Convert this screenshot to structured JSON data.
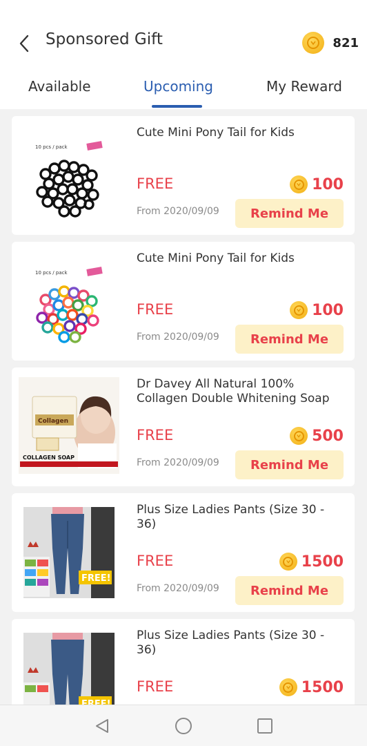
{
  "header": {
    "title": "Sponsored Gift",
    "coin_balance": "821"
  },
  "tabs": [
    {
      "label": "Available"
    },
    {
      "label": "Upcoming",
      "active": true
    },
    {
      "label": "My Reward"
    }
  ],
  "items": [
    {
      "name": "Cute Mini Pony Tail for Kids",
      "price_label": "FREE",
      "coins": "100",
      "date": "From 2020/09/09",
      "action": "Remind Me",
      "image": "black-hair-ties",
      "image_caption": "10 pcs / pack"
    },
    {
      "name": "Cute Mini Pony Tail for Kids",
      "price_label": "FREE",
      "coins": "100",
      "date": "From 2020/09/09",
      "action": "Remind Me",
      "image": "colorful-hair-ties",
      "image_caption": "10 pcs / pack"
    },
    {
      "name": "Dr Davey All Natural 100% Collagen Double Whitening Soap",
      "price_label": "FREE",
      "coins": "500",
      "date": "From 2020/09/09",
      "action": "Remind Me",
      "image": "collagen-soap",
      "image_box_text": "Collagen",
      "image_caption": "COLLAGEN SOAP"
    },
    {
      "name": "Plus Size Ladies Pants (Size 30 - 36)",
      "price_label": "FREE",
      "coins": "1500",
      "date": "From 2020/09/09",
      "action": "Remind Me",
      "image": "jeans",
      "image_badge": "FREE!"
    },
    {
      "name": "Plus Size Ladies Pants (Size 30 - 36)",
      "price_label": "FREE",
      "coins": "1500",
      "image": "jeans",
      "image_badge": "FREE!"
    }
  ],
  "colors": {
    "accent": "#2a5db0",
    "price": "#e8414a",
    "button_bg": "#fdf1c8",
    "coin": "#f2ae12"
  },
  "nav_icons": [
    "back-triangle-icon",
    "home-circle-icon",
    "recents-square-icon"
  ]
}
